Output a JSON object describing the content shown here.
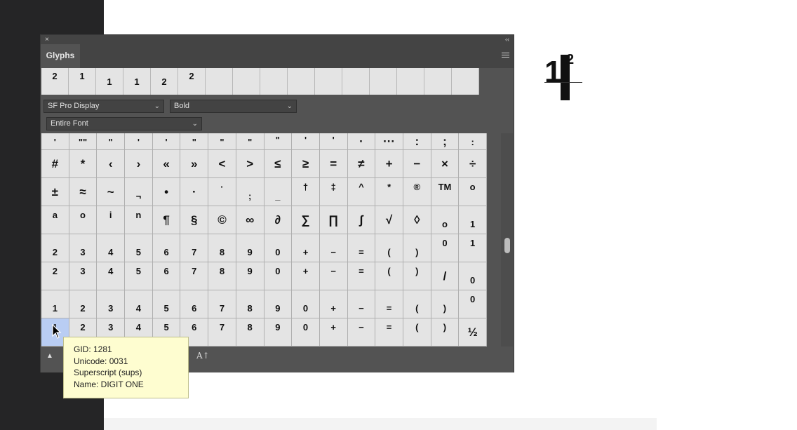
{
  "panel": {
    "tab_label": "Glyphs",
    "close_glyph": "×",
    "collapse_glyph": "‹‹",
    "recent_glyphs": [
      {
        "ch": "2",
        "pos": "sup"
      },
      {
        "ch": "1",
        "pos": "sup"
      },
      {
        "ch": "1",
        "pos": "mid"
      },
      {
        "ch": "1",
        "pos": "mid"
      },
      {
        "ch": "2",
        "pos": "mid"
      },
      {
        "ch": "2",
        "pos": "sup"
      },
      {
        "ch": "",
        "pos": "mid"
      },
      {
        "ch": "",
        "pos": "mid"
      },
      {
        "ch": "",
        "pos": "mid"
      },
      {
        "ch": "",
        "pos": "mid"
      },
      {
        "ch": "",
        "pos": "mid"
      },
      {
        "ch": "",
        "pos": "mid"
      },
      {
        "ch": "",
        "pos": "mid"
      },
      {
        "ch": "",
        "pos": "mid"
      },
      {
        "ch": "",
        "pos": "mid"
      },
      {
        "ch": "",
        "pos": "mid"
      }
    ],
    "font_family": "SF Pro Display",
    "font_style": "Bold",
    "filter": "Entire Font",
    "glyph_rows": [
      [
        {
          "ch": "'",
          "pos": "top"
        },
        {
          "ch": "\"\"",
          "pos": "top"
        },
        {
          "ch": "\"",
          "pos": "top"
        },
        {
          "ch": "'",
          "pos": "top"
        },
        {
          "ch": "'",
          "pos": "top"
        },
        {
          "ch": "\"",
          "pos": "top"
        },
        {
          "ch": "\"",
          "pos": "top"
        },
        {
          "ch": "\"",
          "pos": "top"
        },
        {
          "ch": "\"",
          "pos": "bot"
        },
        {
          "ch": "'",
          "pos": "bot"
        },
        {
          "ch": "'",
          "pos": "bot"
        },
        {
          "ch": "·",
          "pos": "mid"
        },
        {
          "ch": "···",
          "pos": "mid"
        },
        {
          "ch": ":",
          "pos": "mid"
        },
        {
          "ch": ";",
          "pos": "mid"
        },
        {
          "ch": ":",
          "pos": "top"
        }
      ],
      [
        {
          "ch": "#"
        },
        {
          "ch": "*"
        },
        {
          "ch": "‹"
        },
        {
          "ch": "›"
        },
        {
          "ch": "«"
        },
        {
          "ch": "»"
        },
        {
          "ch": "<"
        },
        {
          "ch": ">"
        },
        {
          "ch": "≤"
        },
        {
          "ch": "≥"
        },
        {
          "ch": "="
        },
        {
          "ch": "≠"
        },
        {
          "ch": "+"
        },
        {
          "ch": "−"
        },
        {
          "ch": "×"
        },
        {
          "ch": "÷"
        }
      ],
      [
        {
          "ch": "±"
        },
        {
          "ch": "≈"
        },
        {
          "ch": "~"
        },
        {
          "ch": "¬",
          "pos": "bot"
        },
        {
          "ch": "•"
        },
        {
          "ch": "·"
        },
        {
          "ch": "·",
          "pos": "top"
        },
        {
          "ch": ";",
          "pos": "bot"
        },
        {
          "ch": "_",
          "pos": "bot"
        },
        {
          "ch": "†",
          "pos": "top"
        },
        {
          "ch": "‡",
          "pos": "top"
        },
        {
          "ch": "^",
          "pos": "top"
        },
        {
          "ch": "*",
          "pos": "top"
        },
        {
          "ch": "®",
          "pos": "top"
        },
        {
          "ch": "TM",
          "pos": "top"
        },
        {
          "ch": "o",
          "pos": "top"
        }
      ],
      [
        {
          "ch": "a",
          "pos": "top"
        },
        {
          "ch": "o",
          "pos": "top"
        },
        {
          "ch": "i",
          "pos": "top"
        },
        {
          "ch": "n",
          "pos": "top"
        },
        {
          "ch": "¶"
        },
        {
          "ch": "§"
        },
        {
          "ch": "©"
        },
        {
          "ch": "∞"
        },
        {
          "ch": "∂"
        },
        {
          "ch": "∑"
        },
        {
          "ch": "∏"
        },
        {
          "ch": "∫"
        },
        {
          "ch": "√"
        },
        {
          "ch": "◊"
        },
        {
          "ch": "o",
          "pos": "bot"
        },
        {
          "ch": "1",
          "pos": "bot"
        }
      ],
      [
        {
          "ch": "2",
          "pos": "bot"
        },
        {
          "ch": "3",
          "pos": "bot"
        },
        {
          "ch": "4",
          "pos": "bot"
        },
        {
          "ch": "5",
          "pos": "bot"
        },
        {
          "ch": "6",
          "pos": "bot"
        },
        {
          "ch": "7",
          "pos": "bot"
        },
        {
          "ch": "8",
          "pos": "bot"
        },
        {
          "ch": "9",
          "pos": "bot"
        },
        {
          "ch": "0",
          "pos": "bot"
        },
        {
          "ch": "+",
          "pos": "bot"
        },
        {
          "ch": "−",
          "pos": "bot"
        },
        {
          "ch": "=",
          "pos": "bot"
        },
        {
          "ch": "(",
          "pos": "bot"
        },
        {
          "ch": ")",
          "pos": "bot"
        },
        {
          "ch": "0",
          "pos": "top"
        },
        {
          "ch": "1",
          "pos": "top"
        }
      ],
      [
        {
          "ch": "2",
          "pos": "top"
        },
        {
          "ch": "3",
          "pos": "top"
        },
        {
          "ch": "4",
          "pos": "top"
        },
        {
          "ch": "5",
          "pos": "top"
        },
        {
          "ch": "6",
          "pos": "top"
        },
        {
          "ch": "7",
          "pos": "top"
        },
        {
          "ch": "8",
          "pos": "top"
        },
        {
          "ch": "9",
          "pos": "top"
        },
        {
          "ch": "0",
          "pos": "top"
        },
        {
          "ch": "+",
          "pos": "top"
        },
        {
          "ch": "−",
          "pos": "top"
        },
        {
          "ch": "=",
          "pos": "top"
        },
        {
          "ch": "(",
          "pos": "top"
        },
        {
          "ch": ")",
          "pos": "top"
        },
        {
          "ch": "/"
        },
        {
          "ch": "0",
          "pos": "bot"
        }
      ],
      [
        {
          "ch": "1",
          "pos": "bot"
        },
        {
          "ch": "2",
          "pos": "bot"
        },
        {
          "ch": "3",
          "pos": "bot"
        },
        {
          "ch": "4",
          "pos": "bot"
        },
        {
          "ch": "5",
          "pos": "bot"
        },
        {
          "ch": "6",
          "pos": "bot"
        },
        {
          "ch": "7",
          "pos": "bot"
        },
        {
          "ch": "8",
          "pos": "bot"
        },
        {
          "ch": "9",
          "pos": "bot"
        },
        {
          "ch": "0",
          "pos": "bot"
        },
        {
          "ch": "+",
          "pos": "bot"
        },
        {
          "ch": "−",
          "pos": "bot"
        },
        {
          "ch": "=",
          "pos": "bot"
        },
        {
          "ch": "(",
          "pos": "bot"
        },
        {
          "ch": ")",
          "pos": "bot"
        },
        {
          "ch": "0",
          "pos": "top"
        }
      ],
      [
        {
          "ch": "1",
          "pos": "top",
          "hi": true
        },
        {
          "ch": "2",
          "pos": "top"
        },
        {
          "ch": "3",
          "pos": "top"
        },
        {
          "ch": "4",
          "pos": "top"
        },
        {
          "ch": "5",
          "pos": "top"
        },
        {
          "ch": "6",
          "pos": "top"
        },
        {
          "ch": "7",
          "pos": "top"
        },
        {
          "ch": "8",
          "pos": "top"
        },
        {
          "ch": "9",
          "pos": "top"
        },
        {
          "ch": "0",
          "pos": "top"
        },
        {
          "ch": "+",
          "pos": "top"
        },
        {
          "ch": "−",
          "pos": "top"
        },
        {
          "ch": "=",
          "pos": "top"
        },
        {
          "ch": "(",
          "pos": "top"
        },
        {
          "ch": ")",
          "pos": "top"
        },
        {
          "ch": "½"
        }
      ]
    ],
    "bottom_icons": [
      "mountain-small-icon",
      "font-size-icon"
    ],
    "fontsize_glyph": "A↑"
  },
  "tooltip": {
    "gid": "GID: 1281",
    "unicode": "Unicode: 0031",
    "feature": "Superscript (sups)",
    "name": "Name: DIGIT ONE"
  },
  "preview": {
    "main_text": "1",
    "sup_text": "2"
  },
  "colors": {
    "panel_bg": "#535353",
    "cell_bg": "#e4e4e4",
    "highlight": "#b9cdf3",
    "tooltip_bg": "#fefdd0"
  }
}
